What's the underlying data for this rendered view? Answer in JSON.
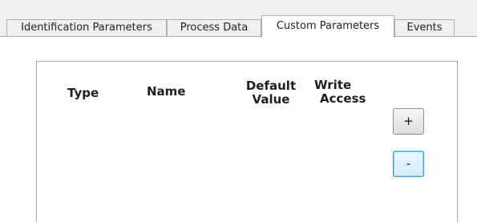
{
  "tabs": [
    {
      "label": "Identification Parameters",
      "active": false
    },
    {
      "label": "Process Data",
      "active": false
    },
    {
      "label": "Custom Parameters",
      "active": true
    },
    {
      "label": "Events",
      "active": false
    }
  ],
  "table": {
    "headers": {
      "type": "Type",
      "name": "Name",
      "default_value_line1": "Default",
      "default_value_line2": "Value",
      "write_access_line1": "Write",
      "write_access_line2": "Access"
    }
  },
  "buttons": {
    "add_label": "+",
    "remove_label": "-"
  },
  "colors": {
    "tab_border": "#adadad",
    "focus_border": "#3c9ad8",
    "tabstrip_bg": "#f0f0f0"
  }
}
